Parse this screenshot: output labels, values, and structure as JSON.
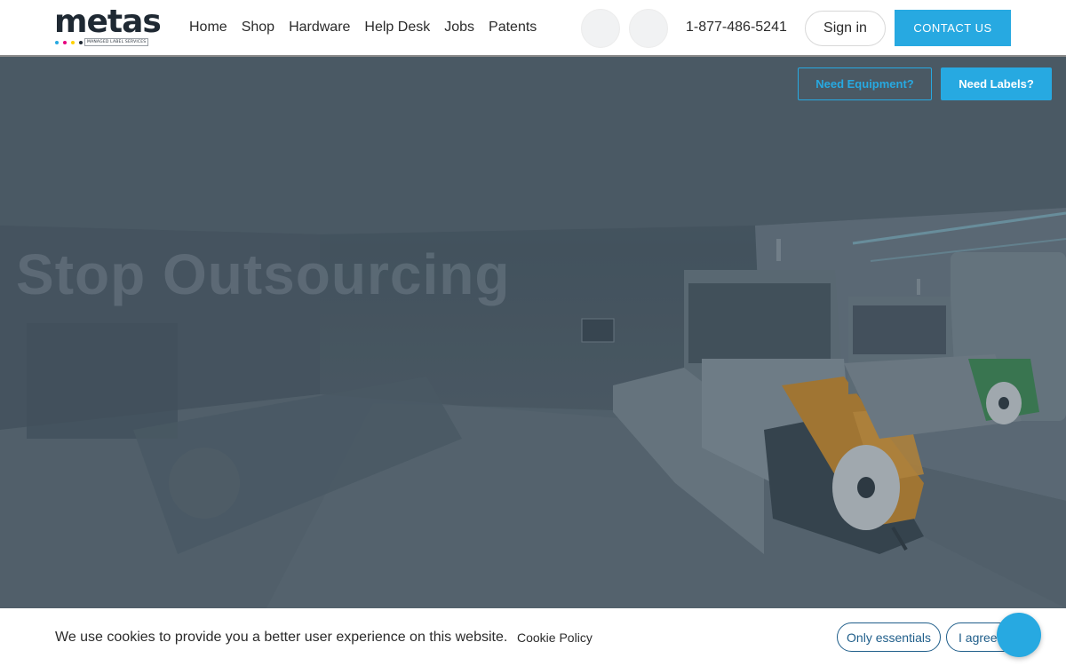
{
  "brand": {
    "name": "metas",
    "tagline": "MANAGED LABEL SERVICES",
    "dot_colors": [
      "#27a9e1",
      "#e6007e",
      "#ffd200",
      "#1f2933"
    ],
    "accent": "#27a9e1"
  },
  "nav": {
    "items": [
      {
        "label": "Home"
      },
      {
        "label": "Shop"
      },
      {
        "label": "Hardware"
      },
      {
        "label": "Help Desk"
      },
      {
        "label": "Jobs"
      },
      {
        "label": "Patents"
      }
    ]
  },
  "header": {
    "phone": "1-877-486-5241",
    "signin_label": "Sign in",
    "contact_label": "CONTACT US"
  },
  "hero": {
    "title": "Stop Outsourcing",
    "equipment_label": "Need Equipment?",
    "labels_label": "Need Labels?"
  },
  "cookie": {
    "message": "We use cookies to provide you a better user experience on this website.",
    "policy_label": "Cookie Policy",
    "essentials_label": "Only essentials",
    "agree_label": "I agree"
  }
}
